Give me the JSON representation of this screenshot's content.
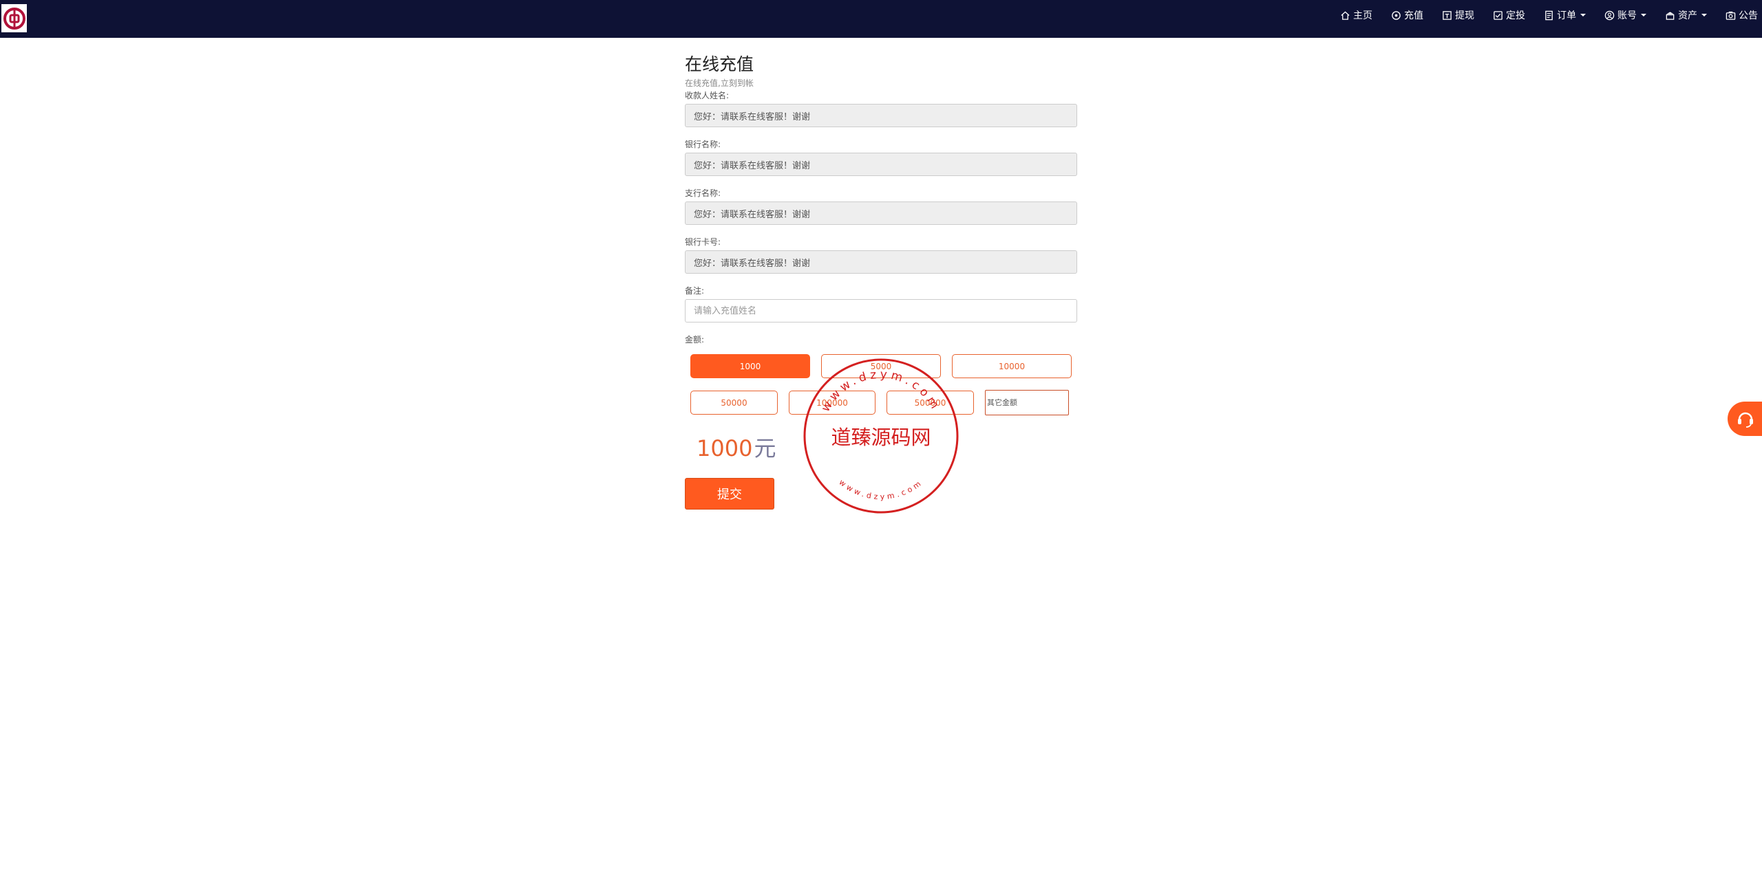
{
  "nav": {
    "items": [
      {
        "label": "主页",
        "icon": "home-icon"
      },
      {
        "label": "充值",
        "icon": "recharge-icon"
      },
      {
        "label": "提现",
        "icon": "withdraw-icon"
      },
      {
        "label": "定投",
        "icon": "checkbox-icon"
      },
      {
        "label": "订单",
        "icon": "document-icon",
        "dropdown": true
      },
      {
        "label": "账号",
        "icon": "user-icon",
        "dropdown": true
      },
      {
        "label": "资产",
        "icon": "wallet-icon",
        "dropdown": true
      },
      {
        "label": "公告",
        "icon": "camera-icon"
      }
    ]
  },
  "page": {
    "title": "在线充值",
    "subtitle": "在线充值,立刻到帐"
  },
  "fields": {
    "payee_name": {
      "label": "收款人姓名:",
      "value": "您好：请联系在线客服！谢谢"
    },
    "bank_name": {
      "label": "银行名称:",
      "value": "您好：请联系在线客服！谢谢"
    },
    "branch_name": {
      "label": "支行名称:",
      "value": "您好：请联系在线客服！谢谢"
    },
    "card_number": {
      "label": "银行卡号:",
      "value": "您好：请联系在线客服！谢谢"
    },
    "remark": {
      "label": "备注:",
      "placeholder": "请输入充值姓名"
    }
  },
  "amount": {
    "label": "金额:",
    "options": [
      "1000",
      "5000",
      "10000",
      "50000",
      "100000",
      "500000"
    ],
    "selected": "1000",
    "other_placeholder": "其它金额",
    "total_value": "1000",
    "total_unit": "元"
  },
  "submit_label": "提交",
  "watermark": {
    "text": "道臻源码网",
    "url_text": "www.dzym.com"
  },
  "colors": {
    "navbar": "#0e1235",
    "accent": "#ff5a1f",
    "stamp": "#d42020"
  }
}
